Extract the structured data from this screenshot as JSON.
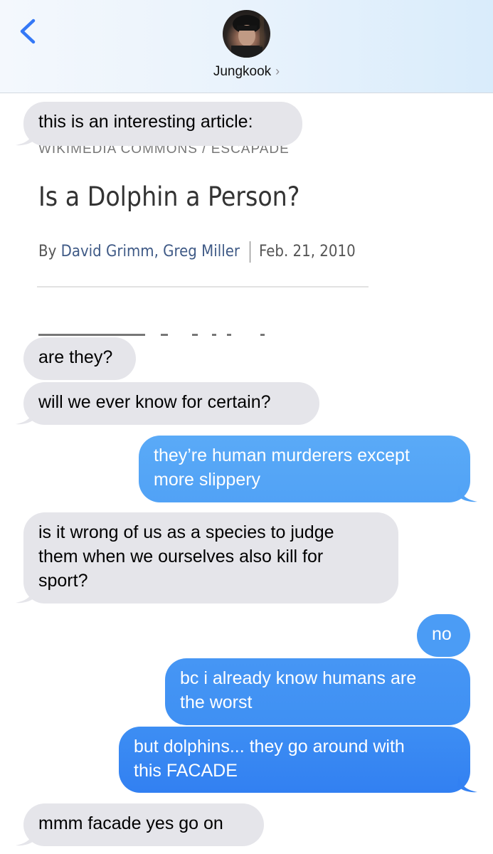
{
  "header": {
    "contact_name": "Jungkook",
    "chevron": "›",
    "back_icon": "chevron-left-icon"
  },
  "article": {
    "credit": "WIKIMEDIA COMMONS / ESCAPADE",
    "title": "Is a Dolphin a Person?",
    "by_prefix": "By",
    "authors": "David Grimm, Greg Miller",
    "date": "Feb. 21, 2010"
  },
  "messages": [
    {
      "from": "them",
      "text": "this is an interesting article:"
    },
    {
      "from": "them",
      "text": "are they?"
    },
    {
      "from": "them",
      "text": "will we ever know for certain?"
    },
    {
      "from": "me",
      "lines": [
        "they’re human murderers except",
        "more slippery"
      ]
    },
    {
      "from": "them",
      "lines": [
        "is it wrong of us as a species to judge",
        "them when we ourselves also kill for",
        "sport?"
      ]
    },
    {
      "from": "me",
      "text": "no"
    },
    {
      "from": "me",
      "lines": [
        "bc i already know humans are",
        "the worst"
      ]
    },
    {
      "from": "me",
      "lines": [
        "but dolphins... they go around with",
        "this FACADE"
      ]
    },
    {
      "from": "them",
      "text": "mmm facade yes go on"
    }
  ],
  "colors": {
    "received_bubble": "#e5e5ea",
    "sent_bubble_top": "#59a8f6",
    "sent_bubble_bottom": "#2f7ef2",
    "ios_blue": "#3478f6"
  }
}
